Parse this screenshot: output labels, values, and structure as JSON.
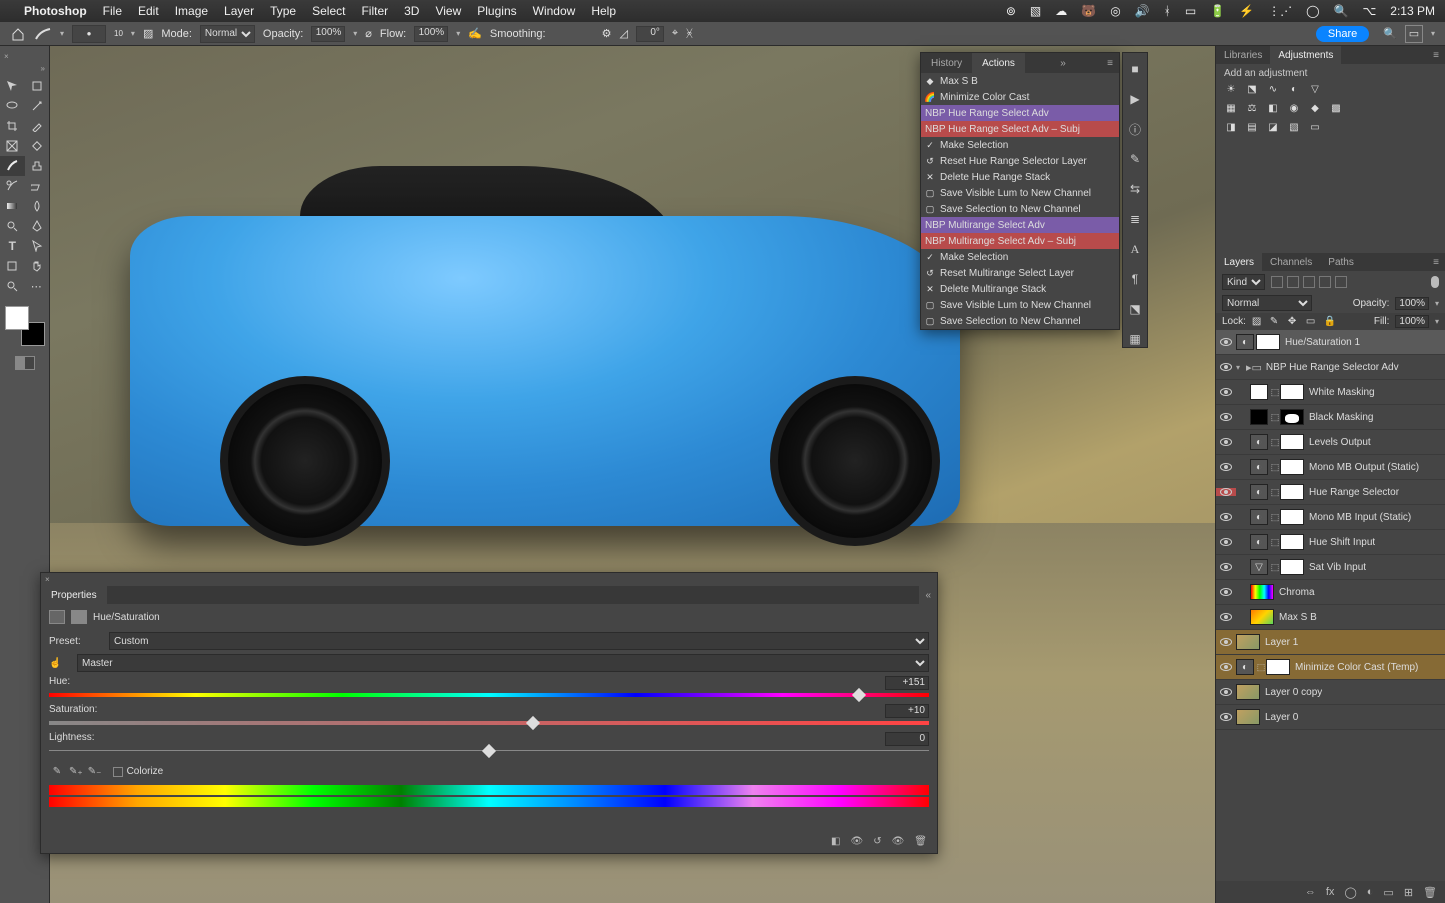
{
  "menubar": {
    "app": "Photoshop",
    "items": [
      "File",
      "Edit",
      "Image",
      "Layer",
      "Type",
      "Select",
      "Filter",
      "3D",
      "View",
      "Plugins",
      "Window",
      "Help"
    ],
    "battery": "",
    "clock": "2:13 PM"
  },
  "optbar": {
    "brush_size": "10",
    "mode_lbl": "Mode:",
    "mode": "Normal",
    "opacity_lbl": "Opacity:",
    "opacity": "100%",
    "flow_lbl": "Flow:",
    "flow": "100%",
    "smoothing_lbl": "Smoothing:",
    "angle": "0°",
    "share": "Share"
  },
  "actions_panel": {
    "tab_history": "History",
    "tab_actions": "Actions",
    "items": [
      {
        "text": "Max S B",
        "cls": "",
        "ic": "◆"
      },
      {
        "text": "Minimize Color Cast",
        "cls": "",
        "ic": "🌈"
      },
      {
        "text": "NBP Hue Range Select Adv",
        "cls": "purple",
        "ic": ""
      },
      {
        "text": "NBP Hue Range Select Adv – Subj",
        "cls": "red",
        "ic": ""
      },
      {
        "text": "Make Selection",
        "cls": "",
        "ic": "✓"
      },
      {
        "text": "Reset Hue Range Selector Layer",
        "cls": "",
        "ic": "↺"
      },
      {
        "text": "Delete Hue Range Stack",
        "cls": "",
        "ic": "✕"
      },
      {
        "text": "Save Visible Lum to New Channel",
        "cls": "",
        "ic": "▢"
      },
      {
        "text": "Save Selection to New Channel",
        "cls": "",
        "ic": "▢"
      },
      {
        "text": "NBP Multirange Select Adv",
        "cls": "purple",
        "ic": ""
      },
      {
        "text": "NBP Multirange Select Adv – Subj",
        "cls": "red",
        "ic": ""
      },
      {
        "text": "Make Selection",
        "cls": "",
        "ic": "✓"
      },
      {
        "text": "Reset Multirange Select Layer",
        "cls": "",
        "ic": "↺"
      },
      {
        "text": "Delete Multirange Stack",
        "cls": "",
        "ic": "✕"
      },
      {
        "text": "Save Visible Lum to New Channel",
        "cls": "",
        "ic": "▢"
      },
      {
        "text": "Save Selection to New Channel",
        "cls": "",
        "ic": "▢"
      }
    ]
  },
  "properties": {
    "title": "Properties",
    "kind": "Hue/Saturation",
    "preset_lbl": "Preset:",
    "preset": "Custom",
    "channel": "Master",
    "hue_lbl": "Hue:",
    "hue": "+151",
    "hue_pct": 92,
    "sat_lbl": "Saturation:",
    "sat": "+10",
    "sat_pct": 55,
    "light_lbl": "Lightness:",
    "light": "0",
    "light_pct": 50,
    "colorize": "Colorize"
  },
  "adjustments": {
    "tab_lib": "Libraries",
    "tab_adj": "Adjustments",
    "caption": "Add an adjustment"
  },
  "layers_panel": {
    "tab_layers": "Layers",
    "tab_channels": "Channels",
    "tab_paths": "Paths",
    "kind": "Kind",
    "blend": "Normal",
    "opacity_lbl": "Opacity:",
    "opacity": "100%",
    "lock_lbl": "Lock:",
    "fill_lbl": "Fill:",
    "fill": "100%"
  },
  "layers": [
    {
      "name": "Hue/Saturation 1",
      "sel": true,
      "indent": 0,
      "thumb1": "icon",
      "thumb2": "white",
      "arrow": ""
    },
    {
      "name": "NBP Hue Range Selector Adv",
      "folder": true,
      "indent": 0,
      "arrow": "▾"
    },
    {
      "name": "White Masking",
      "indent": 1,
      "thumb1": "white",
      "thumb2": "white",
      "link": true
    },
    {
      "name": "Black Masking",
      "indent": 1,
      "thumb1": "black",
      "thumb2": "blackshape",
      "link": true
    },
    {
      "name": "Levels Output",
      "indent": 1,
      "thumb1": "icon",
      "thumb2": "white",
      "link": true
    },
    {
      "name": "Mono MB Output (Static)",
      "indent": 1,
      "thumb1": "icon",
      "thumb2": "white",
      "link": true
    },
    {
      "name": "Hue Range Selector",
      "indent": 1,
      "thumb1": "icon",
      "thumb2": "white",
      "link": true,
      "redvis": true
    },
    {
      "name": "Mono MB Input (Static)",
      "indent": 1,
      "thumb1": "icon",
      "thumb2": "white",
      "link": true
    },
    {
      "name": "Hue Shift Input",
      "indent": 1,
      "thumb1": "icon",
      "thumb2": "white",
      "link": true
    },
    {
      "name": "Sat Vib Input",
      "indent": 1,
      "thumb1": "tri",
      "thumb2": "white",
      "link": true
    },
    {
      "name": "Chroma",
      "indent": 1,
      "thumb1": "",
      "thumb2": "chroma"
    },
    {
      "name": "Max S B",
      "indent": 1,
      "thumb1": "",
      "thumb2": "maxsb"
    },
    {
      "name": "Layer 1",
      "indent": 0,
      "thumb2": "img",
      "hl": true
    },
    {
      "name": "Minimize Color Cast (Temp)",
      "indent": 0,
      "thumb1": "icon",
      "thumb2": "white",
      "hl": true,
      "link": true
    },
    {
      "name": "Layer 0 copy",
      "indent": 0,
      "thumb2": "img"
    },
    {
      "name": "Layer 0",
      "indent": 0,
      "thumb2": "img"
    }
  ]
}
